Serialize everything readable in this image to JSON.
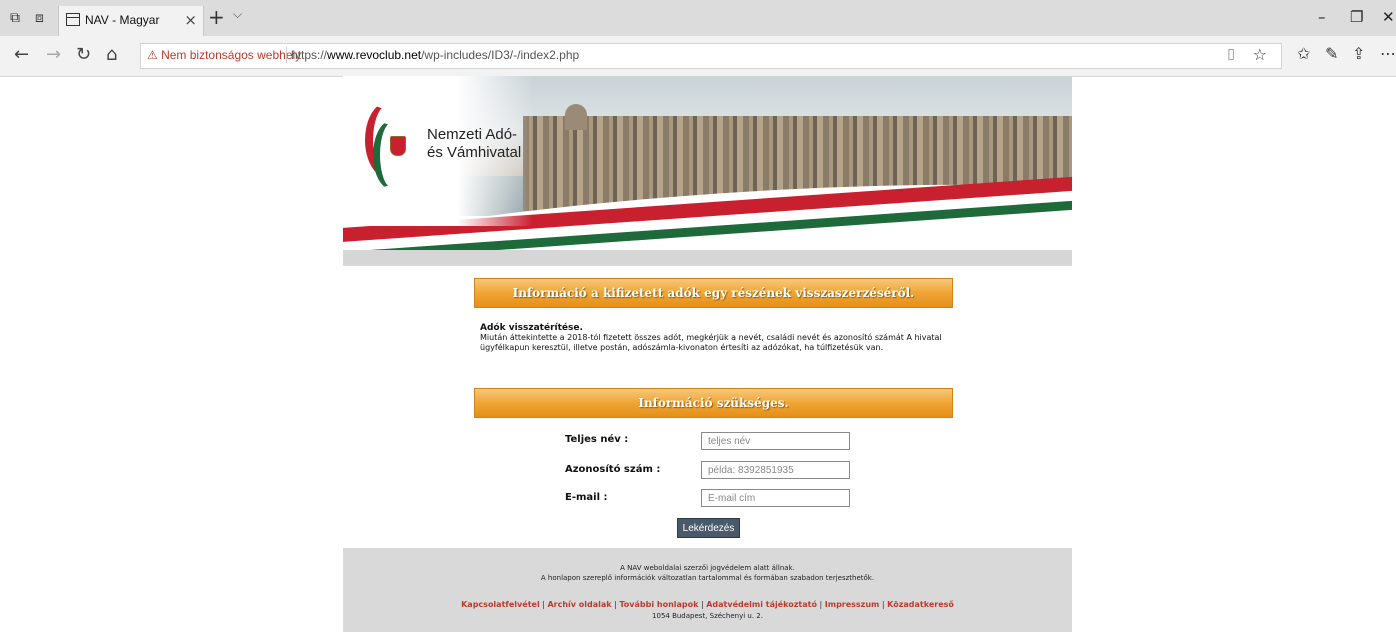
{
  "browser": {
    "tab_title": "NAV - Magyar",
    "tab_close": "×",
    "new_tab": "+",
    "tab_menu": "⌵",
    "security_warning": "⚠ Nem biztonságos webhely",
    "url_prefix": "https://",
    "url_domain": "www.revoclub.net",
    "url_path": "/wp-includes/ID3/-/index2.php",
    "icons": [
      "back-icon",
      "forward-icon",
      "refresh-icon",
      "home-icon",
      "reading-view-icon",
      "favorite-star-icon",
      "favorites-hub-icon",
      "pen-icon",
      "share-icon",
      "more-icon"
    ]
  },
  "header": {
    "logo_line1": "Nemzeti Adó-",
    "logo_line2": "és Vámhivatal"
  },
  "main": {
    "banner1": "Információ a kifizetett adók egy részének visszaszerzéséről.",
    "info_heading": "Adók visszatérítése.",
    "info_text": "Miután áttekintette a 2018-tól fizetett összes adót, megkérjük a nevét, családi nevét és azonosító számát A hivatal ügyfélkapun keresztül, illetve postán, adószámla-kivonaton értesíti az adózókat, ha túlfizetésük van.",
    "banner2": "Információ szükséges.",
    "form": {
      "name_label": "Teljes név :",
      "name_placeholder": "teljes név",
      "id_label": "Azonosító szám :",
      "id_placeholder": "példa: 8392851935",
      "email_label": "E-mail :",
      "email_placeholder": "E-mail cím",
      "submit": "Lekérdezés"
    }
  },
  "footer": {
    "line1": "A NAV weboldalai szerzői jogvédelem alatt állnak.",
    "line2": "A honlapon szereplő információk változatlan tartalommal és formában szabadon terjeszthetők.",
    "links": [
      "Kapcsolatfelvétel",
      "Archív oldalak",
      "További honlapok",
      "Adatvédelmi tájékoztató",
      "Impresszum",
      "Közadatkereső"
    ],
    "address": "1054 Budapest, Széchenyi u. 2."
  },
  "colors": {
    "orange": "#f0a535",
    "red": "#c8202f",
    "green": "#1f6a3b",
    "link": "#c0392b"
  }
}
